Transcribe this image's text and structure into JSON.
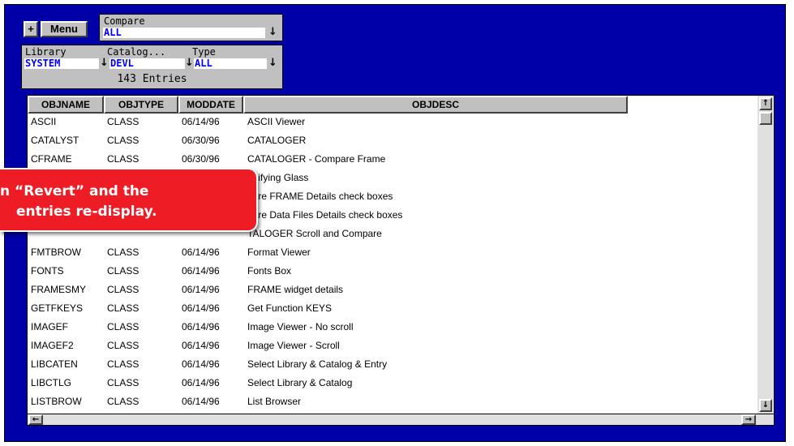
{
  "toolbar": {
    "plus_label": "+",
    "menu_label": "Menu"
  },
  "compare": {
    "label": "Compare",
    "value": "ALL"
  },
  "filters": {
    "library_label": "Library",
    "library_value": "SYSTEM",
    "catalog_label": "Catalog...",
    "catalog_value": "DEVL",
    "type_label": "Type",
    "type_value": "ALL",
    "entries": "143 Entries"
  },
  "table": {
    "columns": [
      "OBJNAME",
      "OBJTYPE",
      "MODDATE",
      "OBJDESC"
    ],
    "rows": [
      {
        "name": "ASCII",
        "type": "CLASS",
        "date": "06/14/96",
        "desc": "ASCII Viewer"
      },
      {
        "name": "CATALYST",
        "type": "CLASS",
        "date": "06/30/96",
        "desc": "CATALOGER"
      },
      {
        "name": "CFRAME",
        "type": "CLASS",
        "date": "06/30/96",
        "desc": "CATALOGER - Compare Frame"
      },
      {
        "name": "",
        "type": "",
        "date": "",
        "desc": "gnifying Glass"
      },
      {
        "name": "",
        "type": "",
        "date": "",
        "desc": "pare FRAME Details check boxes"
      },
      {
        "name": "",
        "type": "",
        "date": "",
        "desc": "pare Data Files Details check boxes"
      },
      {
        "name": "",
        "type": "",
        "date": "",
        "desc": "TALOGER Scroll and Compare"
      },
      {
        "name": "FMTBROW",
        "type": "CLASS",
        "date": "06/14/96",
        "desc": "Format Viewer"
      },
      {
        "name": "FONTS",
        "type": "CLASS",
        "date": "06/14/96",
        "desc": "Fonts Box"
      },
      {
        "name": "FRAMESMY",
        "type": "CLASS",
        "date": "06/14/96",
        "desc": "FRAME widget details"
      },
      {
        "name": "GETFKEYS",
        "type": "CLASS",
        "date": "06/14/96",
        "desc": "Get Function KEYS"
      },
      {
        "name": "IMAGEF",
        "type": "CLASS",
        "date": "06/14/96",
        "desc": "Image Viewer - No scroll"
      },
      {
        "name": "IMAGEF2",
        "type": "CLASS",
        "date": "06/14/96",
        "desc": "Image Viewer - Scroll"
      },
      {
        "name": "LIBCATEN",
        "type": "CLASS",
        "date": "06/14/96",
        "desc": "Select Library & Catalog & Entry"
      },
      {
        "name": "LIBCTLG",
        "type": "CLASS",
        "date": "06/14/96",
        "desc": "Select Library & Catalog"
      },
      {
        "name": "LISTBROW",
        "type": "CLASS",
        "date": "06/14/96",
        "desc": "List Browser"
      }
    ]
  },
  "callout": {
    "line1": "n “Revert” and the",
    "line2": "entries re-display."
  },
  "icons": {
    "dropdown": "down-arrow-icon",
    "scroll_up": "up-arrow-icon",
    "scroll_down": "down-arrow-icon",
    "scroll_left": "left-arrow-icon",
    "scroll_right": "right-arrow-icon"
  },
  "colors": {
    "frame": "#0000a8",
    "panel": "#c0c0c0",
    "value_text": "#0000ff",
    "callout": "#ee1c25"
  }
}
